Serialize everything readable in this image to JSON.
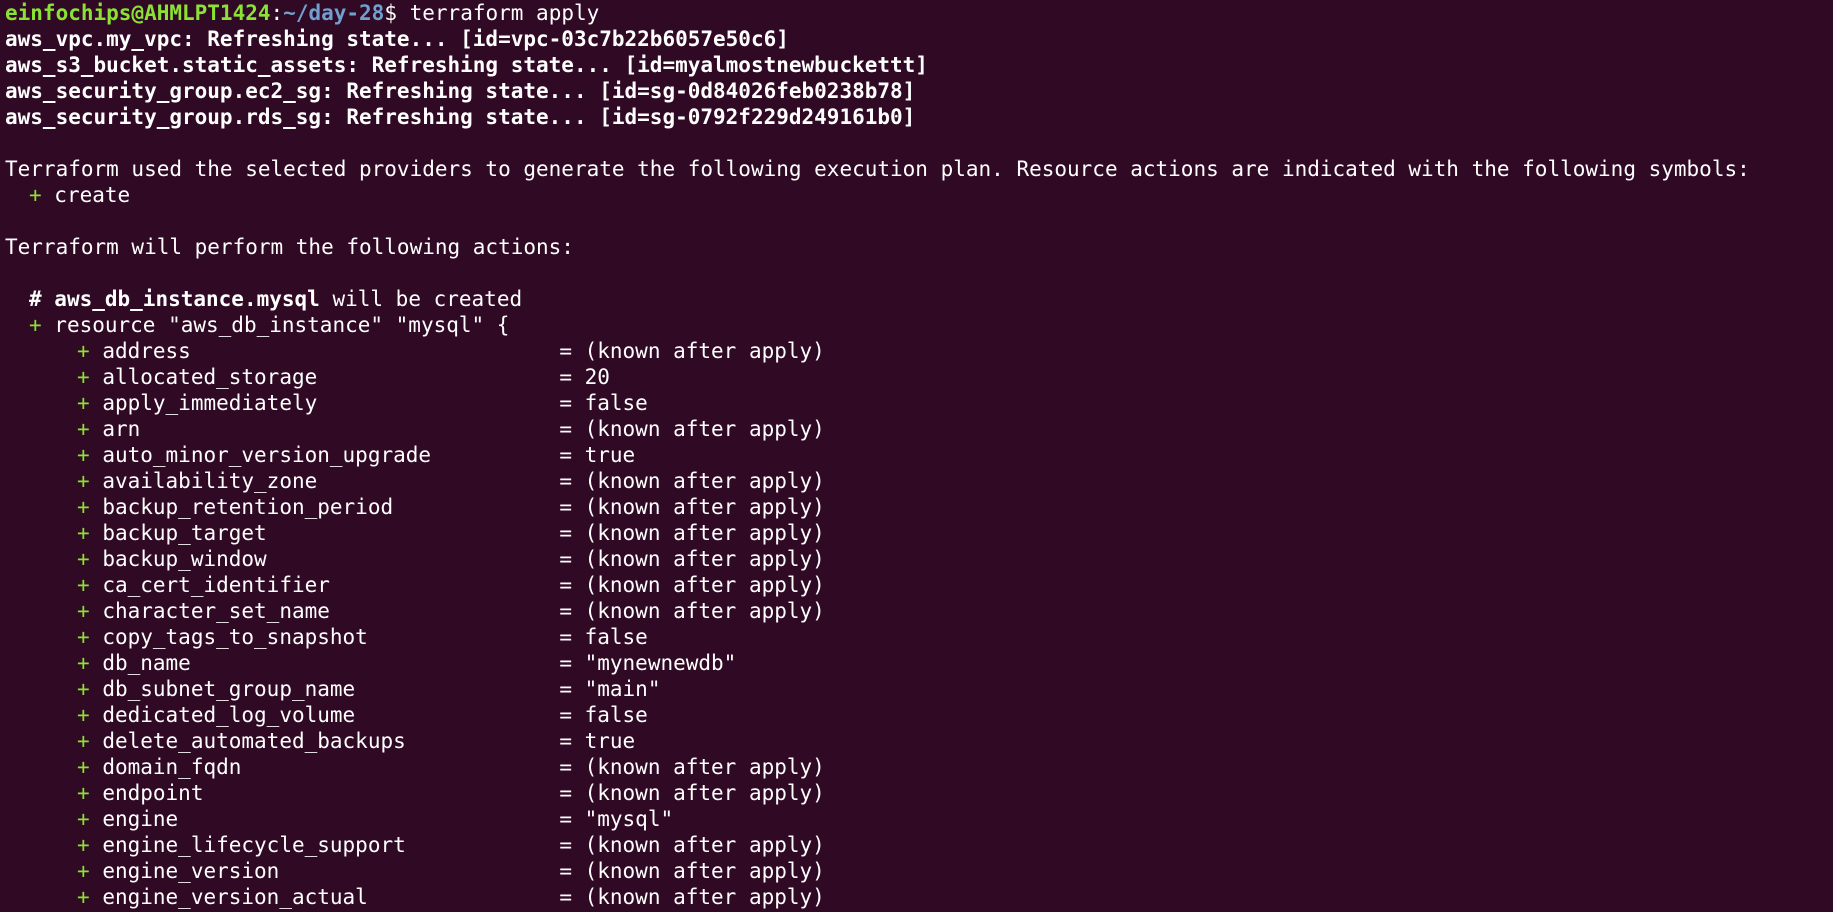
{
  "prompt": {
    "user_host": "einfochips@AHMLPT1424",
    "colon": ":",
    "path": "~/day-28",
    "symbol": "$ ",
    "command": "terraform apply"
  },
  "refresh_lines": [
    "aws_vpc.my_vpc: Refreshing state... [id=vpc-03c7b22b6057e50c6]",
    "aws_s3_bucket.static_assets: Refreshing state... [id=myalmostnewbuckettt]",
    "aws_security_group.ec2_sg: Refreshing state... [id=sg-0d84026feb0238b78]",
    "aws_security_group.rds_sg: Refreshing state... [id=sg-0792f229d249161b0]"
  ],
  "plan_intro": "Terraform used the selected providers to generate the following execution plan. Resource actions are indicated with the following symbols:",
  "symbol_legend": {
    "symbol": "+",
    "label": " create"
  },
  "actions_heading": "Terraform will perform the following actions:",
  "resource": {
    "comment_hash": "# ",
    "address": "aws_db_instance.mysql",
    "will_be": " will be created",
    "plus": "+",
    "declaration": " resource \"aws_db_instance\" \"mysql\" {",
    "attributes": [
      {
        "name": "address",
        "value": "= (known after apply)"
      },
      {
        "name": "allocated_storage",
        "value": "= 20"
      },
      {
        "name": "apply_immediately",
        "value": "= false"
      },
      {
        "name": "arn",
        "value": "= (known after apply)"
      },
      {
        "name": "auto_minor_version_upgrade",
        "value": "= true"
      },
      {
        "name": "availability_zone",
        "value": "= (known after apply)"
      },
      {
        "name": "backup_retention_period",
        "value": "= (known after apply)"
      },
      {
        "name": "backup_target",
        "value": "= (known after apply)"
      },
      {
        "name": "backup_window",
        "value": "= (known after apply)"
      },
      {
        "name": "ca_cert_identifier",
        "value": "= (known after apply)"
      },
      {
        "name": "character_set_name",
        "value": "= (known after apply)"
      },
      {
        "name": "copy_tags_to_snapshot",
        "value": "= false"
      },
      {
        "name": "db_name",
        "value": "= \"mynewnewdb\""
      },
      {
        "name": "db_subnet_group_name",
        "value": "= \"main\""
      },
      {
        "name": "dedicated_log_volume",
        "value": "= false"
      },
      {
        "name": "delete_automated_backups",
        "value": "= true"
      },
      {
        "name": "domain_fqdn",
        "value": "= (known after apply)"
      },
      {
        "name": "endpoint",
        "value": "= (known after apply)"
      },
      {
        "name": "engine",
        "value": "= \"mysql\""
      },
      {
        "name": "engine_lifecycle_support",
        "value": "= (known after apply)"
      },
      {
        "name": "engine_version",
        "value": "= (known after apply)"
      },
      {
        "name": "engine_version_actual",
        "value": "= (known after apply)"
      }
    ]
  },
  "colors": {
    "background": "#300a24",
    "foreground": "#ffffff",
    "prompt_user": "#8ae234",
    "prompt_path": "#729fcf",
    "plus_symbol": "#8ae234"
  }
}
